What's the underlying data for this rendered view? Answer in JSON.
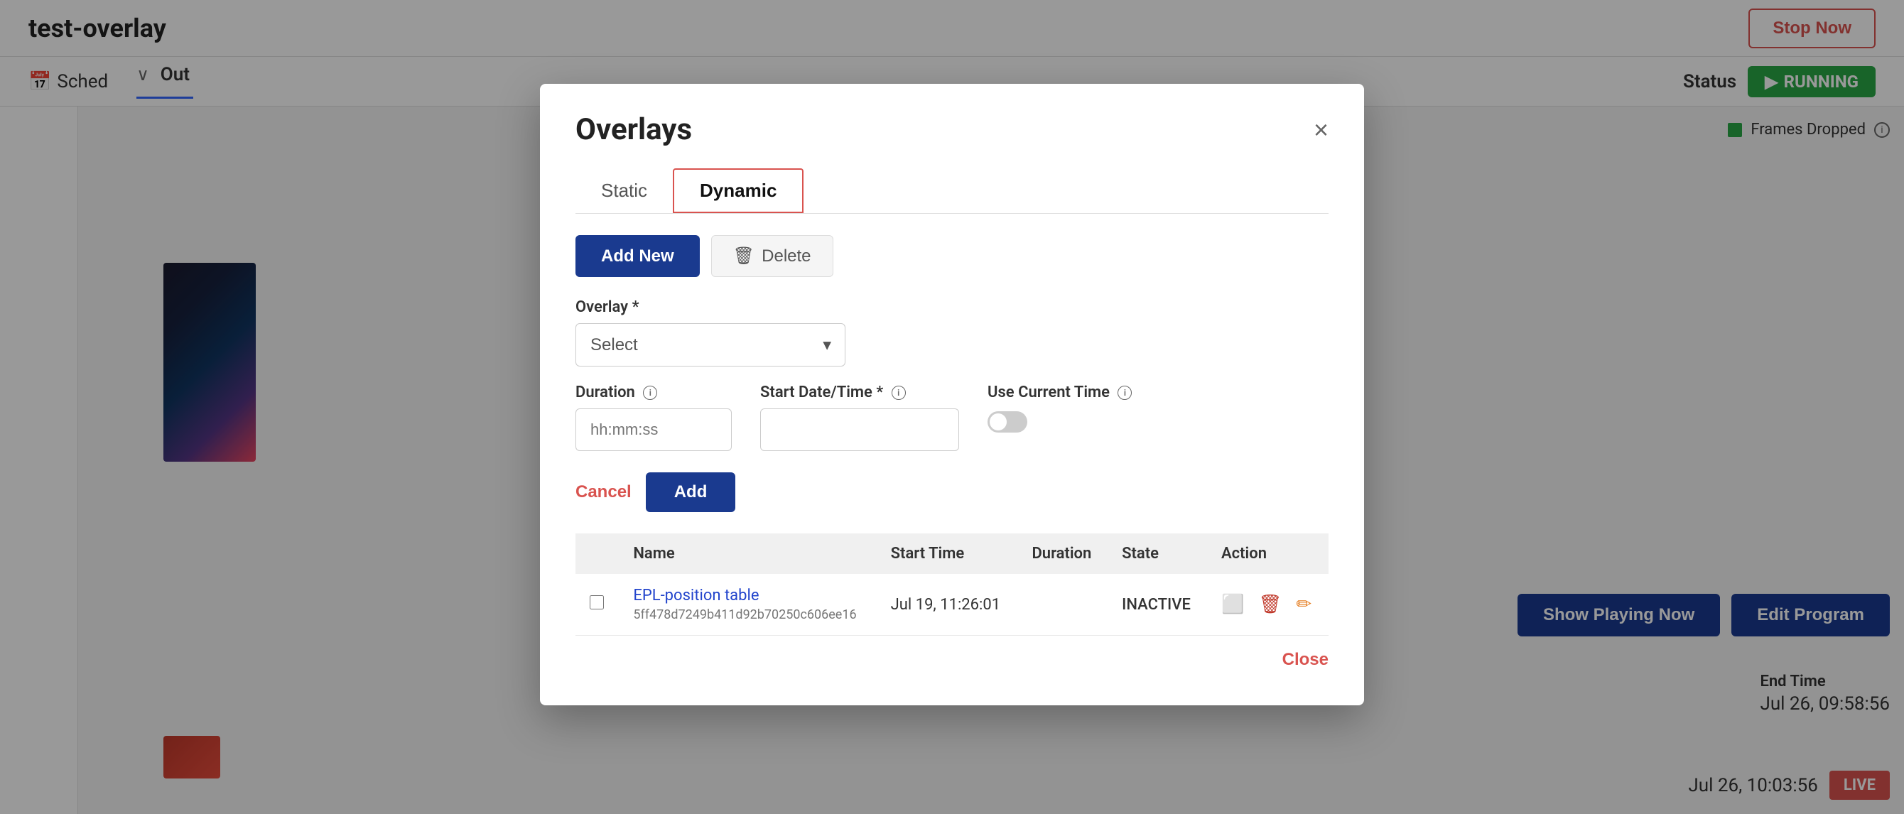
{
  "app": {
    "title": "test-overlay",
    "stop_now_label": "Stop Now"
  },
  "secondary_bar": {
    "schedule_label": "Sched",
    "status_label": "Status",
    "running_label": "RUNNING"
  },
  "output": {
    "label": "Out"
  },
  "frames_dropped": {
    "label": "Frames Dropped"
  },
  "end_time": {
    "label": "End Time",
    "value": "Jul 26, 09:58:56"
  },
  "bottom": {
    "time": "Jul 26, 10:03:56",
    "live": "LIVE"
  },
  "buttons": {
    "show_playing_now": "Show Playing Now",
    "edit_program": "Edit Program"
  },
  "modal": {
    "title": "Overlays",
    "close_label": "×",
    "tabs": [
      {
        "label": "Static",
        "active": false
      },
      {
        "label": "Dynamic",
        "active": true
      }
    ],
    "add_new_label": "Add New",
    "delete_label": "Delete",
    "overlay_label": "Overlay *",
    "select_placeholder": "Select",
    "duration_label": "Duration",
    "duration_placeholder": "hh:mm:ss",
    "start_datetime_label": "Start Date/Time *",
    "use_current_time_label": "Use Current Time",
    "cancel_label": "Cancel",
    "add_label": "Add",
    "table": {
      "columns": [
        "",
        "Name",
        "Start Time",
        "Duration",
        "State",
        "Action"
      ],
      "rows": [
        {
          "checked": false,
          "name": "EPL-position table",
          "id": "5ff478d7249b411d92b70250c606ee16",
          "start_time": "Jul 19, 11:26:01",
          "duration": "",
          "state": "INACTIVE"
        }
      ]
    },
    "close_btn_label": "Close"
  }
}
